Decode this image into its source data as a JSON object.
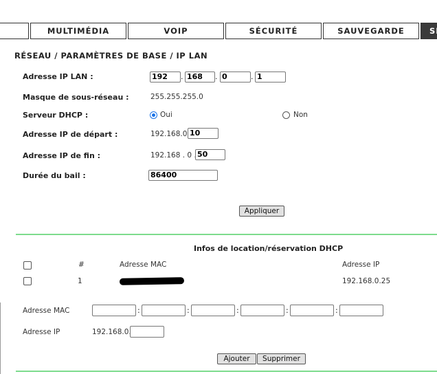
{
  "tabs": [
    {
      "label": ""
    },
    {
      "label": "MULTIMÉDIA"
    },
    {
      "label": "VOIP"
    },
    {
      "label": "SÉCURITÉ"
    },
    {
      "label": "SAUVEGARDE"
    },
    {
      "label": "SE"
    }
  ],
  "page_title": "RÉSEAU / PARAMÈTRES DE BASE / IP LAN",
  "lan": {
    "ip_label": "Adresse IP LAN :",
    "ip_octets": [
      "192",
      "168",
      "0",
      "1"
    ],
    "mask_label": "Masque de sous-réseau :",
    "mask_value": "255.255.255.0",
    "dhcp_label": "Serveur DHCP :",
    "dhcp_on_label": "Oui",
    "dhcp_off_label": "Non",
    "dhcp_selected": "Oui",
    "start_label": "Adresse IP de départ :",
    "start_prefix": "192.168.0.",
    "start_value": "10",
    "end_label": "Adresse IP de fin :",
    "end_prefix": "192.168 . 0 .",
    "end_value": "50",
    "lease_label": "Durée du bail :",
    "lease_value": "86400",
    "apply_label": "Appliquer"
  },
  "dhcp_table": {
    "title": "Infos de location/réservation DHCP",
    "headers": {
      "num": "#",
      "mac": "Adresse MAC",
      "ip": "Adresse IP"
    },
    "rows": [
      {
        "num": "1",
        "mac": "",
        "ip": "192.168.0.25"
      }
    ]
  },
  "reservation": {
    "mac_label": "Adresse MAC",
    "ip_label": "Adresse IP",
    "ip_prefix": "192.168.0.",
    "add_label": "Ajouter",
    "delete_label": "Supprimer"
  },
  "colors": {
    "divider": "#7ddb8d",
    "radio_selected": "#1a73e8",
    "tab_active": "#3a3a3a"
  }
}
